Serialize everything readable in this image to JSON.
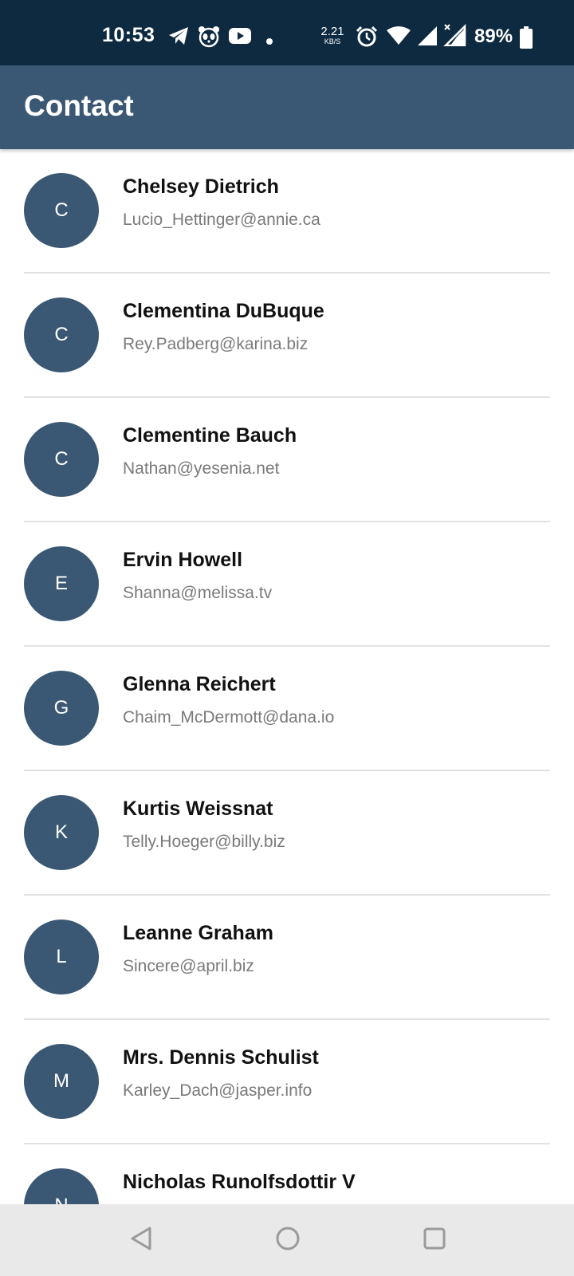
{
  "status_bar": {
    "time": "10:53",
    "net_rate": "2.21",
    "net_unit": "KB/S",
    "battery_pct": "89%",
    "icons": [
      "telegram-icon",
      "panda-icon",
      "youtube-icon",
      "dot-icon",
      "alarm-icon",
      "wifi-icon",
      "signal-icon",
      "signal-no-data-icon",
      "battery-icon"
    ]
  },
  "app_bar": {
    "title": "Contact"
  },
  "colors": {
    "status_bar": "#0d2a40",
    "app_bar": "#3a5874",
    "avatar": "#3a5874",
    "email_text": "#7a7a7a"
  },
  "contacts": [
    {
      "initial": "C",
      "name": "Chelsey Dietrich",
      "email": "Lucio_Hettinger@annie.ca"
    },
    {
      "initial": "C",
      "name": "Clementina DuBuque",
      "email": "Rey.Padberg@karina.biz"
    },
    {
      "initial": "C",
      "name": "Clementine Bauch",
      "email": "Nathan@yesenia.net"
    },
    {
      "initial": "E",
      "name": "Ervin Howell",
      "email": "Shanna@melissa.tv"
    },
    {
      "initial": "G",
      "name": "Glenna Reichert",
      "email": "Chaim_McDermott@dana.io"
    },
    {
      "initial": "K",
      "name": "Kurtis Weissnat",
      "email": "Telly.Hoeger@billy.biz"
    },
    {
      "initial": "L",
      "name": "Leanne Graham",
      "email": "Sincere@april.biz"
    },
    {
      "initial": "M",
      "name": "Mrs. Dennis Schulist",
      "email": "Karley_Dach@jasper.info"
    },
    {
      "initial": "N",
      "name": "Nicholas Runolfsdottir V",
      "email": ""
    }
  ],
  "nav_bar": {
    "buttons": [
      "back-icon",
      "home-icon",
      "recents-icon"
    ]
  }
}
